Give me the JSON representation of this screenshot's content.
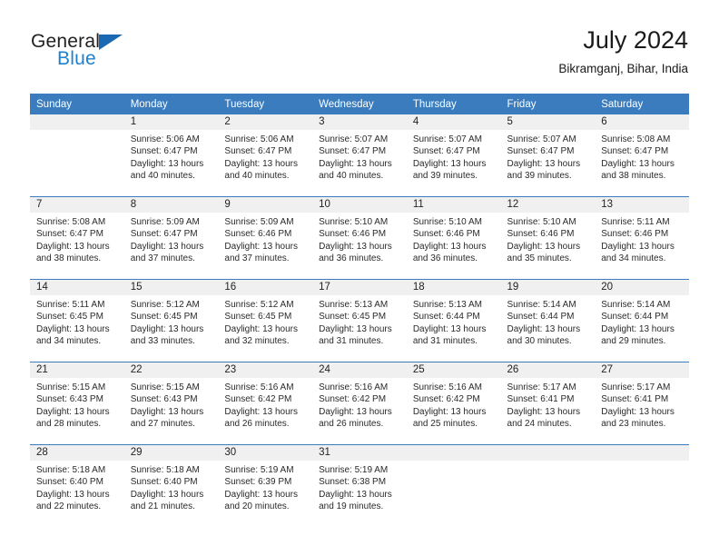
{
  "brand": {
    "name_part1": "General",
    "name_part2": "Blue",
    "accent_color": "#2081d0",
    "triangle_color": "#1c69b3"
  },
  "header": {
    "title": "July 2024",
    "subtitle": "Bikramganj, Bihar, India"
  },
  "calendar": {
    "header_bg": "#3a7cbe",
    "daynum_bg": "#f0f0f0",
    "weekday_headers": [
      "Sunday",
      "Monday",
      "Tuesday",
      "Wednesday",
      "Thursday",
      "Friday",
      "Saturday"
    ],
    "weeks": [
      [
        {
          "day": "",
          "sunrise": "",
          "sunset": "",
          "daylight_line1": "",
          "daylight_line2": ""
        },
        {
          "day": "1",
          "sunrise": "Sunrise: 5:06 AM",
          "sunset": "Sunset: 6:47 PM",
          "daylight_line1": "Daylight: 13 hours",
          "daylight_line2": "and 40 minutes."
        },
        {
          "day": "2",
          "sunrise": "Sunrise: 5:06 AM",
          "sunset": "Sunset: 6:47 PM",
          "daylight_line1": "Daylight: 13 hours",
          "daylight_line2": "and 40 minutes."
        },
        {
          "day": "3",
          "sunrise": "Sunrise: 5:07 AM",
          "sunset": "Sunset: 6:47 PM",
          "daylight_line1": "Daylight: 13 hours",
          "daylight_line2": "and 40 minutes."
        },
        {
          "day": "4",
          "sunrise": "Sunrise: 5:07 AM",
          "sunset": "Sunset: 6:47 PM",
          "daylight_line1": "Daylight: 13 hours",
          "daylight_line2": "and 39 minutes."
        },
        {
          "day": "5",
          "sunrise": "Sunrise: 5:07 AM",
          "sunset": "Sunset: 6:47 PM",
          "daylight_line1": "Daylight: 13 hours",
          "daylight_line2": "and 39 minutes."
        },
        {
          "day": "6",
          "sunrise": "Sunrise: 5:08 AM",
          "sunset": "Sunset: 6:47 PM",
          "daylight_line1": "Daylight: 13 hours",
          "daylight_line2": "and 38 minutes."
        }
      ],
      [
        {
          "day": "7",
          "sunrise": "Sunrise: 5:08 AM",
          "sunset": "Sunset: 6:47 PM",
          "daylight_line1": "Daylight: 13 hours",
          "daylight_line2": "and 38 minutes."
        },
        {
          "day": "8",
          "sunrise": "Sunrise: 5:09 AM",
          "sunset": "Sunset: 6:47 PM",
          "daylight_line1": "Daylight: 13 hours",
          "daylight_line2": "and 37 minutes."
        },
        {
          "day": "9",
          "sunrise": "Sunrise: 5:09 AM",
          "sunset": "Sunset: 6:46 PM",
          "daylight_line1": "Daylight: 13 hours",
          "daylight_line2": "and 37 minutes."
        },
        {
          "day": "10",
          "sunrise": "Sunrise: 5:10 AM",
          "sunset": "Sunset: 6:46 PM",
          "daylight_line1": "Daylight: 13 hours",
          "daylight_line2": "and 36 minutes."
        },
        {
          "day": "11",
          "sunrise": "Sunrise: 5:10 AM",
          "sunset": "Sunset: 6:46 PM",
          "daylight_line1": "Daylight: 13 hours",
          "daylight_line2": "and 36 minutes."
        },
        {
          "day": "12",
          "sunrise": "Sunrise: 5:10 AM",
          "sunset": "Sunset: 6:46 PM",
          "daylight_line1": "Daylight: 13 hours",
          "daylight_line2": "and 35 minutes."
        },
        {
          "day": "13",
          "sunrise": "Sunrise: 5:11 AM",
          "sunset": "Sunset: 6:46 PM",
          "daylight_line1": "Daylight: 13 hours",
          "daylight_line2": "and 34 minutes."
        }
      ],
      [
        {
          "day": "14",
          "sunrise": "Sunrise: 5:11 AM",
          "sunset": "Sunset: 6:45 PM",
          "daylight_line1": "Daylight: 13 hours",
          "daylight_line2": "and 34 minutes."
        },
        {
          "day": "15",
          "sunrise": "Sunrise: 5:12 AM",
          "sunset": "Sunset: 6:45 PM",
          "daylight_line1": "Daylight: 13 hours",
          "daylight_line2": "and 33 minutes."
        },
        {
          "day": "16",
          "sunrise": "Sunrise: 5:12 AM",
          "sunset": "Sunset: 6:45 PM",
          "daylight_line1": "Daylight: 13 hours",
          "daylight_line2": "and 32 minutes."
        },
        {
          "day": "17",
          "sunrise": "Sunrise: 5:13 AM",
          "sunset": "Sunset: 6:45 PM",
          "daylight_line1": "Daylight: 13 hours",
          "daylight_line2": "and 31 minutes."
        },
        {
          "day": "18",
          "sunrise": "Sunrise: 5:13 AM",
          "sunset": "Sunset: 6:44 PM",
          "daylight_line1": "Daylight: 13 hours",
          "daylight_line2": "and 31 minutes."
        },
        {
          "day": "19",
          "sunrise": "Sunrise: 5:14 AM",
          "sunset": "Sunset: 6:44 PM",
          "daylight_line1": "Daylight: 13 hours",
          "daylight_line2": "and 30 minutes."
        },
        {
          "day": "20",
          "sunrise": "Sunrise: 5:14 AM",
          "sunset": "Sunset: 6:44 PM",
          "daylight_line1": "Daylight: 13 hours",
          "daylight_line2": "and 29 minutes."
        }
      ],
      [
        {
          "day": "21",
          "sunrise": "Sunrise: 5:15 AM",
          "sunset": "Sunset: 6:43 PM",
          "daylight_line1": "Daylight: 13 hours",
          "daylight_line2": "and 28 minutes."
        },
        {
          "day": "22",
          "sunrise": "Sunrise: 5:15 AM",
          "sunset": "Sunset: 6:43 PM",
          "daylight_line1": "Daylight: 13 hours",
          "daylight_line2": "and 27 minutes."
        },
        {
          "day": "23",
          "sunrise": "Sunrise: 5:16 AM",
          "sunset": "Sunset: 6:42 PM",
          "daylight_line1": "Daylight: 13 hours",
          "daylight_line2": "and 26 minutes."
        },
        {
          "day": "24",
          "sunrise": "Sunrise: 5:16 AM",
          "sunset": "Sunset: 6:42 PM",
          "daylight_line1": "Daylight: 13 hours",
          "daylight_line2": "and 26 minutes."
        },
        {
          "day": "25",
          "sunrise": "Sunrise: 5:16 AM",
          "sunset": "Sunset: 6:42 PM",
          "daylight_line1": "Daylight: 13 hours",
          "daylight_line2": "and 25 minutes."
        },
        {
          "day": "26",
          "sunrise": "Sunrise: 5:17 AM",
          "sunset": "Sunset: 6:41 PM",
          "daylight_line1": "Daylight: 13 hours",
          "daylight_line2": "and 24 minutes."
        },
        {
          "day": "27",
          "sunrise": "Sunrise: 5:17 AM",
          "sunset": "Sunset: 6:41 PM",
          "daylight_line1": "Daylight: 13 hours",
          "daylight_line2": "and 23 minutes."
        }
      ],
      [
        {
          "day": "28",
          "sunrise": "Sunrise: 5:18 AM",
          "sunset": "Sunset: 6:40 PM",
          "daylight_line1": "Daylight: 13 hours",
          "daylight_line2": "and 22 minutes."
        },
        {
          "day": "29",
          "sunrise": "Sunrise: 5:18 AM",
          "sunset": "Sunset: 6:40 PM",
          "daylight_line1": "Daylight: 13 hours",
          "daylight_line2": "and 21 minutes."
        },
        {
          "day": "30",
          "sunrise": "Sunrise: 5:19 AM",
          "sunset": "Sunset: 6:39 PM",
          "daylight_line1": "Daylight: 13 hours",
          "daylight_line2": "and 20 minutes."
        },
        {
          "day": "31",
          "sunrise": "Sunrise: 5:19 AM",
          "sunset": "Sunset: 6:38 PM",
          "daylight_line1": "Daylight: 13 hours",
          "daylight_line2": "and 19 minutes."
        },
        {
          "day": "",
          "sunrise": "",
          "sunset": "",
          "daylight_line1": "",
          "daylight_line2": ""
        },
        {
          "day": "",
          "sunrise": "",
          "sunset": "",
          "daylight_line1": "",
          "daylight_line2": ""
        },
        {
          "day": "",
          "sunrise": "",
          "sunset": "",
          "daylight_line1": "",
          "daylight_line2": ""
        }
      ]
    ]
  }
}
